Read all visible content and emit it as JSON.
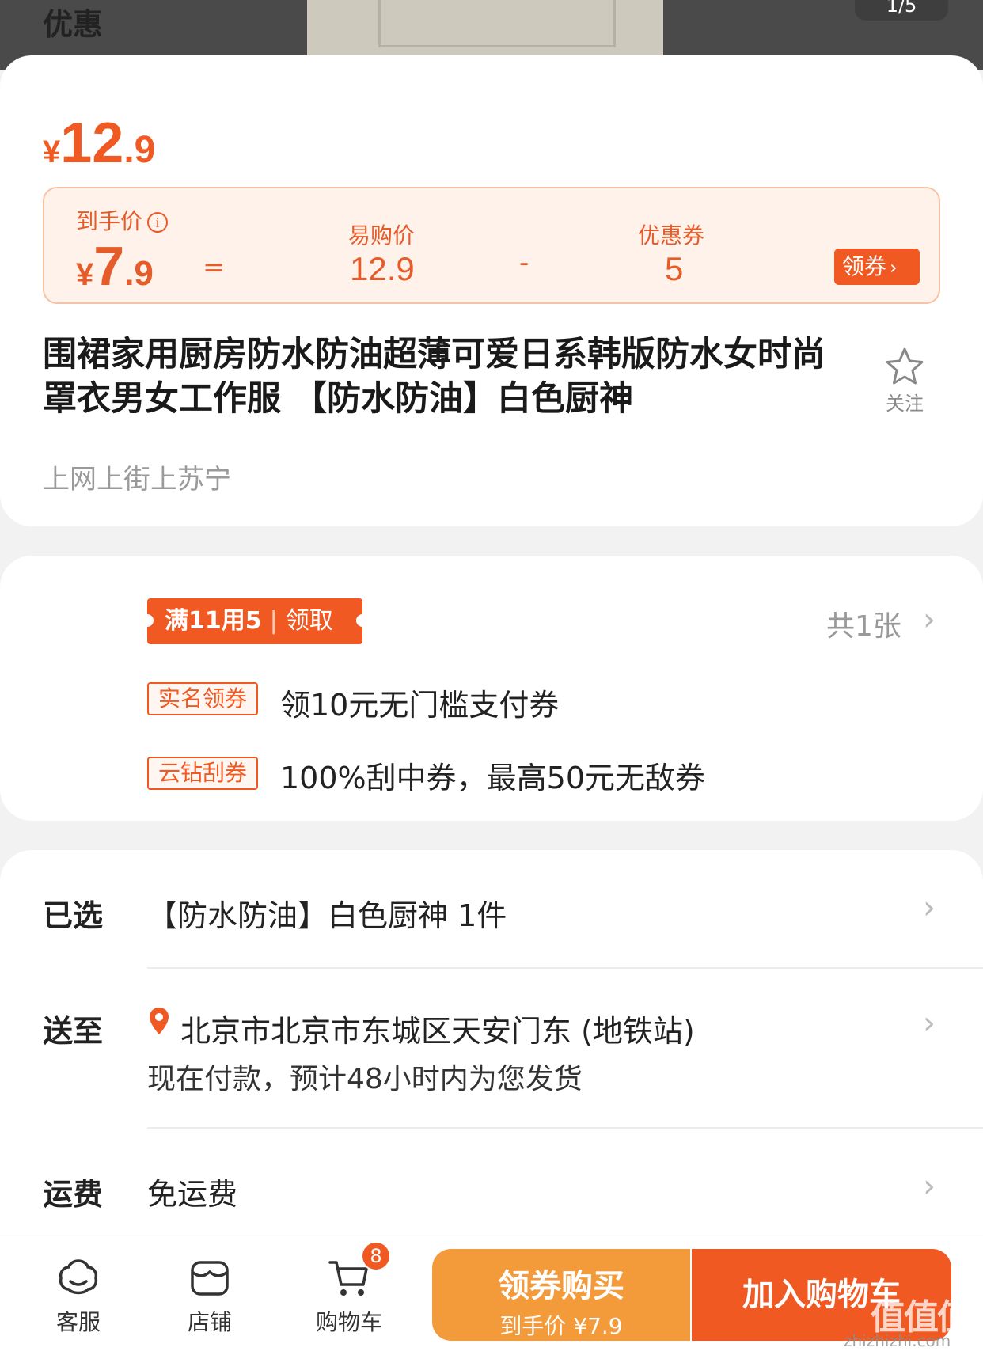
{
  "gallery": {
    "indicator": "1/5"
  },
  "price": {
    "currency": "¥",
    "integer": "12",
    "decimal": ".9"
  },
  "final_price": {
    "label": "到手价",
    "info_icon": "i",
    "currency": "¥",
    "integer": "7",
    "decimal": ".9",
    "equals": "=",
    "yigou_label": "易购价",
    "yigou_value": "12.9",
    "minus": "-",
    "coupon_label": "优惠券",
    "coupon_value": "5",
    "get_coupon": "领券",
    "get_coupon_chevron": "›"
  },
  "product": {
    "title": "围裙家用厨房防水防油超薄可爱日系韩版防水女时尚罩衣男女工作服 【防水防油】白色厨神",
    "follow_label": "关注",
    "slogan": "上网上街上苏宁"
  },
  "promotions": {
    "label": "优惠",
    "main_coupon": {
      "text": "满11用5",
      "separator": "|",
      "action": "领取"
    },
    "count": "共1张",
    "items": [
      {
        "tag": "实名领券",
        "text": "领10元无门槛支付券"
      },
      {
        "tag": "云钻刮券",
        "text": "100%刮中券，最高50元无敌券"
      }
    ]
  },
  "selected": {
    "label": "已选",
    "value": "【防水防油】白色厨神  1件"
  },
  "delivery": {
    "label": "送至",
    "address": "北京市北京市东城区天安门东 (地铁站)",
    "note": "现在付款，预计48小时内为您发货"
  },
  "shipping": {
    "label": "运费",
    "value": "免运费"
  },
  "chevron": "›",
  "bottom_bar": {
    "service": "客服",
    "shop": "店铺",
    "cart": "购物车",
    "cart_count": "8",
    "buy_label": "领券购买",
    "buy_sub": "到手价 ¥7.9",
    "add_cart": "加入购物车"
  },
  "watermark": {
    "logo": "值值值",
    "url": "zhizhizhi.com"
  },
  "colors": {
    "accent": "#f05a22",
    "orange_button": "#f39b3a",
    "coupon_bg": "#fff2ea"
  }
}
